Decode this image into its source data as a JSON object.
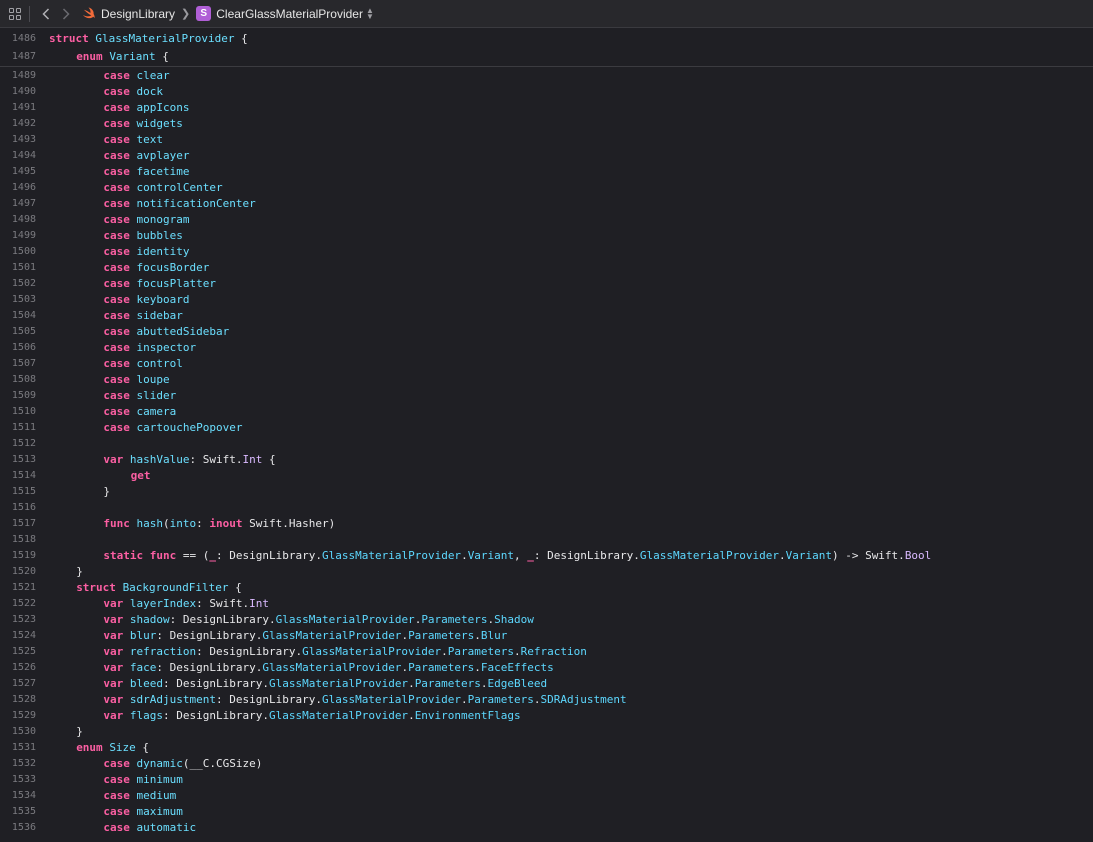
{
  "toolbar": {
    "breadcrumb_project": "DesignLibrary",
    "breadcrumb_symbol_badge": "S",
    "breadcrumb_symbol": "ClearGlassMaterialProvider"
  },
  "colors": {
    "background": "#1f1f24",
    "keyword": "#fc5fa3",
    "identifier": "#6bdfff",
    "type": "#dabaff",
    "plain": "#e8e8ea",
    "line_number": "#7b7b80",
    "symbol_badge": "#b05fd6"
  },
  "icons": [
    "navigator-grid-icon",
    "back-chevron-icon",
    "forward-chevron-icon",
    "swift-icon",
    "struct-badge-icon",
    "updown-chevron-icon"
  ],
  "sticky_lines": [
    {
      "n": "1486",
      "indent": 0,
      "tokens": [
        [
          "kw",
          "struct"
        ],
        [
          "pl",
          " "
        ],
        [
          "id",
          "GlassMaterialProvider"
        ],
        [
          "pl",
          " {"
        ]
      ]
    },
    {
      "n": "1487",
      "indent": 1,
      "tokens": [
        [
          "kw",
          "enum"
        ],
        [
          "pl",
          " "
        ],
        [
          "id",
          "Variant"
        ],
        [
          "pl",
          " {"
        ]
      ]
    }
  ],
  "lines": [
    {
      "n": "1489",
      "indent": 2,
      "tokens": [
        [
          "kw",
          "case"
        ],
        [
          "pl",
          " "
        ],
        [
          "id",
          "clear"
        ]
      ]
    },
    {
      "n": "1490",
      "indent": 2,
      "tokens": [
        [
          "kw",
          "case"
        ],
        [
          "pl",
          " "
        ],
        [
          "id",
          "dock"
        ]
      ]
    },
    {
      "n": "1491",
      "indent": 2,
      "tokens": [
        [
          "kw",
          "case"
        ],
        [
          "pl",
          " "
        ],
        [
          "id",
          "appIcons"
        ]
      ]
    },
    {
      "n": "1492",
      "indent": 2,
      "tokens": [
        [
          "kw",
          "case"
        ],
        [
          "pl",
          " "
        ],
        [
          "id",
          "widgets"
        ]
      ]
    },
    {
      "n": "1493",
      "indent": 2,
      "tokens": [
        [
          "kw",
          "case"
        ],
        [
          "pl",
          " "
        ],
        [
          "id",
          "text"
        ]
      ]
    },
    {
      "n": "1494",
      "indent": 2,
      "tokens": [
        [
          "kw",
          "case"
        ],
        [
          "pl",
          " "
        ],
        [
          "id",
          "avplayer"
        ]
      ]
    },
    {
      "n": "1495",
      "indent": 2,
      "tokens": [
        [
          "kw",
          "case"
        ],
        [
          "pl",
          " "
        ],
        [
          "id",
          "facetime"
        ]
      ]
    },
    {
      "n": "1496",
      "indent": 2,
      "tokens": [
        [
          "kw",
          "case"
        ],
        [
          "pl",
          " "
        ],
        [
          "id",
          "controlCenter"
        ]
      ]
    },
    {
      "n": "1497",
      "indent": 2,
      "tokens": [
        [
          "kw",
          "case"
        ],
        [
          "pl",
          " "
        ],
        [
          "id",
          "notificationCenter"
        ]
      ]
    },
    {
      "n": "1498",
      "indent": 2,
      "tokens": [
        [
          "kw",
          "case"
        ],
        [
          "pl",
          " "
        ],
        [
          "id",
          "monogram"
        ]
      ]
    },
    {
      "n": "1499",
      "indent": 2,
      "tokens": [
        [
          "kw",
          "case"
        ],
        [
          "pl",
          " "
        ],
        [
          "id",
          "bubbles"
        ]
      ]
    },
    {
      "n": "1500",
      "indent": 2,
      "tokens": [
        [
          "kw",
          "case"
        ],
        [
          "pl",
          " "
        ],
        [
          "id",
          "identity"
        ]
      ]
    },
    {
      "n": "1501",
      "indent": 2,
      "tokens": [
        [
          "kw",
          "case"
        ],
        [
          "pl",
          " "
        ],
        [
          "id",
          "focusBorder"
        ]
      ]
    },
    {
      "n": "1502",
      "indent": 2,
      "tokens": [
        [
          "kw",
          "case"
        ],
        [
          "pl",
          " "
        ],
        [
          "id",
          "focusPlatter"
        ]
      ]
    },
    {
      "n": "1503",
      "indent": 2,
      "tokens": [
        [
          "kw",
          "case"
        ],
        [
          "pl",
          " "
        ],
        [
          "id",
          "keyboard"
        ]
      ]
    },
    {
      "n": "1504",
      "indent": 2,
      "tokens": [
        [
          "kw",
          "case"
        ],
        [
          "pl",
          " "
        ],
        [
          "id",
          "sidebar"
        ]
      ]
    },
    {
      "n": "1505",
      "indent": 2,
      "tokens": [
        [
          "kw",
          "case"
        ],
        [
          "pl",
          " "
        ],
        [
          "id",
          "abuttedSidebar"
        ]
      ]
    },
    {
      "n": "1506",
      "indent": 2,
      "tokens": [
        [
          "kw",
          "case"
        ],
        [
          "pl",
          " "
        ],
        [
          "id",
          "inspector"
        ]
      ]
    },
    {
      "n": "1507",
      "indent": 2,
      "tokens": [
        [
          "kw",
          "case"
        ],
        [
          "pl",
          " "
        ],
        [
          "id",
          "control"
        ]
      ]
    },
    {
      "n": "1508",
      "indent": 2,
      "tokens": [
        [
          "kw",
          "case"
        ],
        [
          "pl",
          " "
        ],
        [
          "id",
          "loupe"
        ]
      ]
    },
    {
      "n": "1509",
      "indent": 2,
      "tokens": [
        [
          "kw",
          "case"
        ],
        [
          "pl",
          " "
        ],
        [
          "id",
          "slider"
        ]
      ]
    },
    {
      "n": "1510",
      "indent": 2,
      "tokens": [
        [
          "kw",
          "case"
        ],
        [
          "pl",
          " "
        ],
        [
          "id",
          "camera"
        ]
      ]
    },
    {
      "n": "1511",
      "indent": 2,
      "tokens": [
        [
          "kw",
          "case"
        ],
        [
          "pl",
          " "
        ],
        [
          "id",
          "cartouchePopover"
        ]
      ]
    },
    {
      "n": "1512",
      "indent": 0,
      "tokens": []
    },
    {
      "n": "1513",
      "indent": 2,
      "tokens": [
        [
          "kw",
          "var"
        ],
        [
          "pl",
          " "
        ],
        [
          "id",
          "hashValue"
        ],
        [
          "pl",
          ": Swift."
        ],
        [
          "ty",
          "Int"
        ],
        [
          "pl",
          " {"
        ]
      ]
    },
    {
      "n": "1514",
      "indent": 3,
      "tokens": [
        [
          "kw",
          "get"
        ]
      ]
    },
    {
      "n": "1515",
      "indent": 2,
      "tokens": [
        [
          "pl",
          "}"
        ]
      ]
    },
    {
      "n": "1516",
      "indent": 0,
      "tokens": []
    },
    {
      "n": "1517",
      "indent": 2,
      "tokens": [
        [
          "kw",
          "func"
        ],
        [
          "pl",
          " "
        ],
        [
          "id",
          "hash"
        ],
        [
          "pl",
          "("
        ],
        [
          "id",
          "into"
        ],
        [
          "pl",
          ": "
        ],
        [
          "kw",
          "inout"
        ],
        [
          "pl",
          " Swift.Hasher)"
        ]
      ]
    },
    {
      "n": "1518",
      "indent": 0,
      "tokens": []
    },
    {
      "n": "1519",
      "indent": 2,
      "tokens": [
        [
          "kw",
          "static"
        ],
        [
          "pl",
          " "
        ],
        [
          "kw",
          "func"
        ],
        [
          "pl",
          " == ("
        ],
        [
          "kw",
          "_"
        ],
        [
          "pl",
          ": DesignLibrary."
        ],
        [
          "tyb",
          "GlassMaterialProvider"
        ],
        [
          "pl",
          "."
        ],
        [
          "tyb",
          "Variant"
        ],
        [
          "pl",
          ", "
        ],
        [
          "kw",
          "_"
        ],
        [
          "pl",
          ": DesignLibrary."
        ],
        [
          "tyb",
          "GlassMaterialProvider"
        ],
        [
          "pl",
          "."
        ],
        [
          "tyb",
          "Variant"
        ],
        [
          "pl",
          ") -> Swift."
        ],
        [
          "ty",
          "Bool"
        ]
      ]
    },
    {
      "n": "1520",
      "indent": 1,
      "tokens": [
        [
          "pl",
          "}"
        ]
      ]
    },
    {
      "n": "1521",
      "indent": 1,
      "tokens": [
        [
          "kw",
          "struct"
        ],
        [
          "pl",
          " "
        ],
        [
          "id",
          "BackgroundFilter"
        ],
        [
          "pl",
          " {"
        ]
      ]
    },
    {
      "n": "1522",
      "indent": 2,
      "tokens": [
        [
          "kw",
          "var"
        ],
        [
          "pl",
          " "
        ],
        [
          "id",
          "layerIndex"
        ],
        [
          "pl",
          ": Swift."
        ],
        [
          "ty",
          "Int"
        ]
      ]
    },
    {
      "n": "1523",
      "indent": 2,
      "tokens": [
        [
          "kw",
          "var"
        ],
        [
          "pl",
          " "
        ],
        [
          "id",
          "shadow"
        ],
        [
          "pl",
          ": DesignLibrary."
        ],
        [
          "tyb",
          "GlassMaterialProvider"
        ],
        [
          "pl",
          "."
        ],
        [
          "tyb",
          "Parameters"
        ],
        [
          "pl",
          "."
        ],
        [
          "tyb",
          "Shadow"
        ]
      ]
    },
    {
      "n": "1524",
      "indent": 2,
      "tokens": [
        [
          "kw",
          "var"
        ],
        [
          "pl",
          " "
        ],
        [
          "id",
          "blur"
        ],
        [
          "pl",
          ": DesignLibrary."
        ],
        [
          "tyb",
          "GlassMaterialProvider"
        ],
        [
          "pl",
          "."
        ],
        [
          "tyb",
          "Parameters"
        ],
        [
          "pl",
          "."
        ],
        [
          "tyb",
          "Blur"
        ]
      ]
    },
    {
      "n": "1525",
      "indent": 2,
      "tokens": [
        [
          "kw",
          "var"
        ],
        [
          "pl",
          " "
        ],
        [
          "id",
          "refraction"
        ],
        [
          "pl",
          ": DesignLibrary."
        ],
        [
          "tyb",
          "GlassMaterialProvider"
        ],
        [
          "pl",
          "."
        ],
        [
          "tyb",
          "Parameters"
        ],
        [
          "pl",
          "."
        ],
        [
          "tyb",
          "Refraction"
        ]
      ]
    },
    {
      "n": "1526",
      "indent": 2,
      "tokens": [
        [
          "kw",
          "var"
        ],
        [
          "pl",
          " "
        ],
        [
          "id",
          "face"
        ],
        [
          "pl",
          ": DesignLibrary."
        ],
        [
          "tyb",
          "GlassMaterialProvider"
        ],
        [
          "pl",
          "."
        ],
        [
          "tyb",
          "Parameters"
        ],
        [
          "pl",
          "."
        ],
        [
          "tyb",
          "FaceEffects"
        ]
      ]
    },
    {
      "n": "1527",
      "indent": 2,
      "tokens": [
        [
          "kw",
          "var"
        ],
        [
          "pl",
          " "
        ],
        [
          "id",
          "bleed"
        ],
        [
          "pl",
          ": DesignLibrary."
        ],
        [
          "tyb",
          "GlassMaterialProvider"
        ],
        [
          "pl",
          "."
        ],
        [
          "tyb",
          "Parameters"
        ],
        [
          "pl",
          "."
        ],
        [
          "tyb",
          "EdgeBleed"
        ]
      ]
    },
    {
      "n": "1528",
      "indent": 2,
      "tokens": [
        [
          "kw",
          "var"
        ],
        [
          "pl",
          " "
        ],
        [
          "id",
          "sdrAdjustment"
        ],
        [
          "pl",
          ": DesignLibrary."
        ],
        [
          "tyb",
          "GlassMaterialProvider"
        ],
        [
          "pl",
          "."
        ],
        [
          "tyb",
          "Parameters"
        ],
        [
          "pl",
          "."
        ],
        [
          "tyb",
          "SDRAdjustment"
        ]
      ]
    },
    {
      "n": "1529",
      "indent": 2,
      "tokens": [
        [
          "kw",
          "var"
        ],
        [
          "pl",
          " "
        ],
        [
          "id",
          "flags"
        ],
        [
          "pl",
          ": DesignLibrary."
        ],
        [
          "tyb",
          "GlassMaterialProvider"
        ],
        [
          "pl",
          "."
        ],
        [
          "tyb",
          "EnvironmentFlags"
        ]
      ]
    },
    {
      "n": "1530",
      "indent": 1,
      "tokens": [
        [
          "pl",
          "}"
        ]
      ]
    },
    {
      "n": "1531",
      "indent": 1,
      "tokens": [
        [
          "kw",
          "enum"
        ],
        [
          "pl",
          " "
        ],
        [
          "id",
          "Size"
        ],
        [
          "pl",
          " {"
        ]
      ]
    },
    {
      "n": "1532",
      "indent": 2,
      "tokens": [
        [
          "kw",
          "case"
        ],
        [
          "pl",
          " "
        ],
        [
          "id",
          "dynamic"
        ],
        [
          "pl",
          "(__C.CGSize)"
        ]
      ]
    },
    {
      "n": "1533",
      "indent": 2,
      "tokens": [
        [
          "kw",
          "case"
        ],
        [
          "pl",
          " "
        ],
        [
          "id",
          "minimum"
        ]
      ]
    },
    {
      "n": "1534",
      "indent": 2,
      "tokens": [
        [
          "kw",
          "case"
        ],
        [
          "pl",
          " "
        ],
        [
          "id",
          "medium"
        ]
      ]
    },
    {
      "n": "1535",
      "indent": 2,
      "tokens": [
        [
          "kw",
          "case"
        ],
        [
          "pl",
          " "
        ],
        [
          "id",
          "maximum"
        ]
      ]
    },
    {
      "n": "1536",
      "indent": 2,
      "tokens": [
        [
          "kw",
          "case"
        ],
        [
          "pl",
          " "
        ],
        [
          "id",
          "automatic"
        ]
      ]
    }
  ]
}
